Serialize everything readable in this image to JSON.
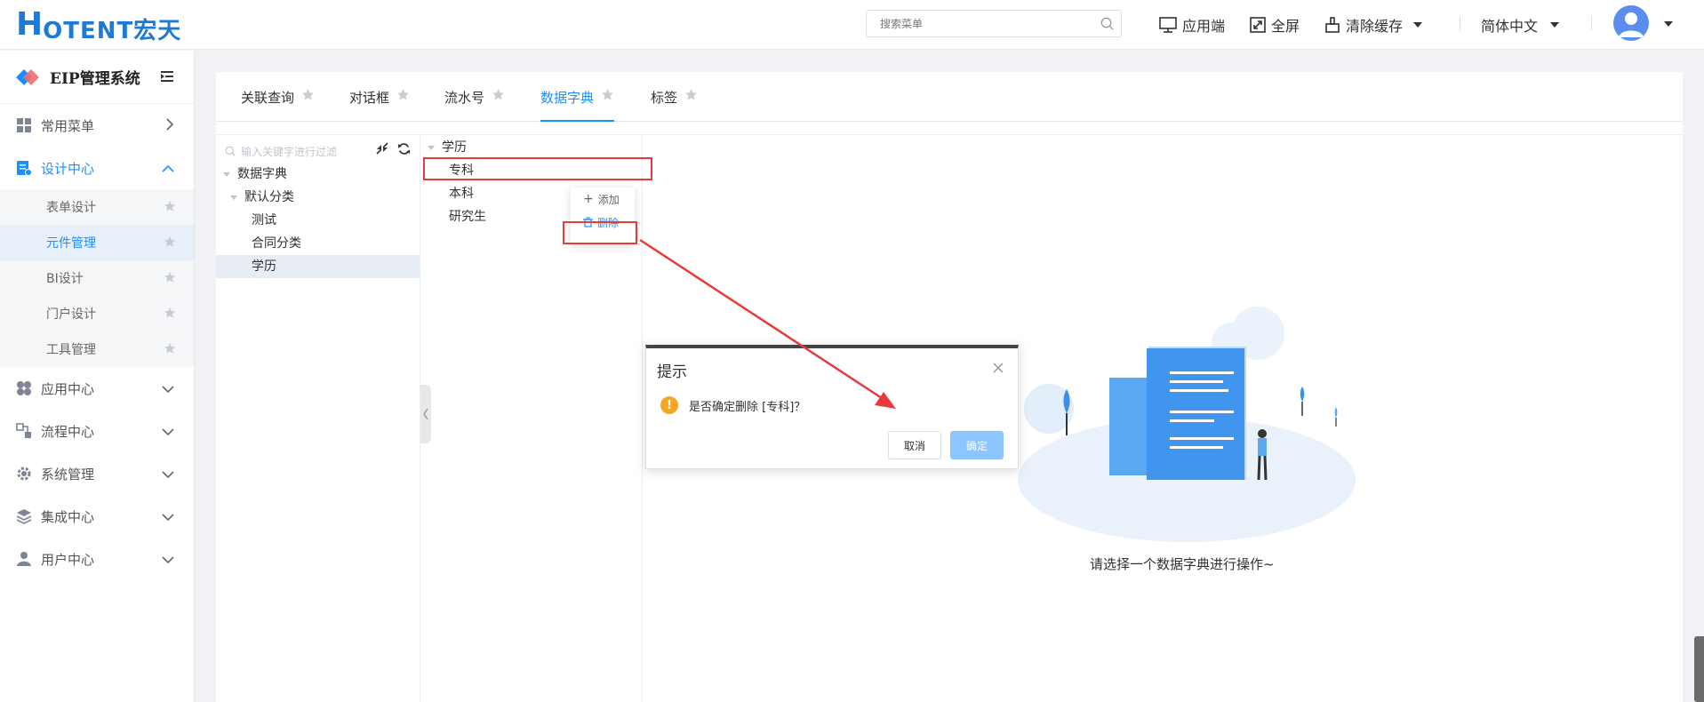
{
  "header": {
    "logo_h": "H",
    "logo_rest": "OTENT宏天",
    "search_placeholder": "搜索菜单",
    "client_label": "应用端",
    "fullscreen_label": "全屏",
    "clear_cache_label": "清除缓存",
    "language_label": "简体中文"
  },
  "sidebar": {
    "brand": "EIP管理系统",
    "menu": [
      {
        "label": "常用菜单",
        "icon": "grid-icon"
      },
      {
        "label": "设计中心",
        "icon": "design-icon",
        "expanded": true
      },
      {
        "label": "应用中心",
        "icon": "apps-icon"
      },
      {
        "label": "流程中心",
        "icon": "flow-icon"
      },
      {
        "label": "系统管理",
        "icon": "gear-icon"
      },
      {
        "label": "集成中心",
        "icon": "layers-icon"
      },
      {
        "label": "用户中心",
        "icon": "user-icon"
      }
    ],
    "design_sub": [
      {
        "label": "表单设计"
      },
      {
        "label": "元件管理",
        "selected": true
      },
      {
        "label": "BI设计"
      },
      {
        "label": "门户设计"
      },
      {
        "label": "工具管理"
      }
    ]
  },
  "tabs": [
    {
      "label": "关联查询"
    },
    {
      "label": "对话框"
    },
    {
      "label": "流水号"
    },
    {
      "label": "数据字典",
      "active": true
    },
    {
      "label": "标签"
    }
  ],
  "left_tree": {
    "filter_placeholder": "输入关键字进行过滤",
    "nodes": [
      "数据字典",
      "默认分类",
      "测试",
      "合同分类",
      "学历"
    ]
  },
  "mid_tree": {
    "root": "学历",
    "children": [
      "专科",
      "本科",
      "研究生"
    ]
  },
  "context_menu": {
    "add_label": "添加",
    "delete_label": "删除"
  },
  "dialog": {
    "title": "提示",
    "message": "是否确定删除 [专科]？",
    "cancel": "取消",
    "confirm": "确定"
  },
  "empty_state": {
    "text": "请选择一个数据字典进行操作~"
  },
  "colors": {
    "primary": "#1890ff",
    "warning": "#f5a623",
    "annotation_red": "#e83a3a"
  }
}
